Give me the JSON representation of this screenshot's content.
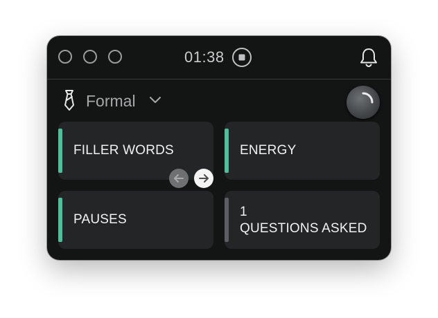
{
  "titlebar": {
    "timer": "01:38",
    "icons": [
      "close-icon",
      "minimize-icon",
      "zoom-icon",
      "stop-record-icon",
      "bell-icon"
    ]
  },
  "mode": {
    "label": "Formal",
    "icon": "tie-icon"
  },
  "cards": [
    {
      "label": "FILLER WORDS",
      "value": "",
      "indicator_color": "#4fbf9a"
    },
    {
      "label": "ENERGY",
      "value": "",
      "indicator_color": "#4fbf9a"
    },
    {
      "label": "PAUSES",
      "value": "",
      "indicator_color": "#4fbf9a"
    },
    {
      "label": "QUESTIONS ASKED",
      "value": "1",
      "indicator_color": "#5c5f62"
    }
  ],
  "pager": {
    "prev_icon": "arrow-left-icon",
    "next_icon": "arrow-right-icon"
  },
  "colors": {
    "window_bg": "#131414",
    "card_bg": "#232526",
    "accent_green": "#4fbf9a",
    "text_primary": "#f2f2f2",
    "text_muted": "#a6a8aa"
  }
}
